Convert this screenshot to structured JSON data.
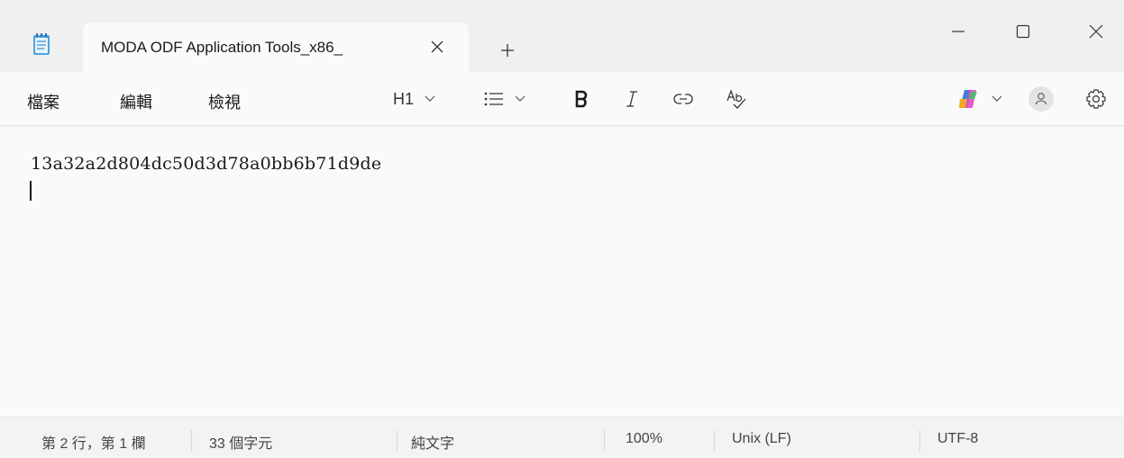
{
  "tab": {
    "title": "MODA ODF Application Tools_x86_"
  },
  "menu": {
    "file": "檔案",
    "edit": "編輯",
    "view": "檢視"
  },
  "toolbar": {
    "heading": "H1"
  },
  "editor": {
    "line1": "13a32a2d804dc50d3d78a0bb6b71d9de"
  },
  "status": {
    "position": "第 2 行，第 1 欄",
    "chars": "33 個字元",
    "format": "純文字",
    "zoom": "100%",
    "line_ending": "Unix (LF)",
    "encoding": "UTF-8"
  },
  "colors": {
    "accent": "#4a8fd8",
    "copilot": "#e04cc0"
  }
}
